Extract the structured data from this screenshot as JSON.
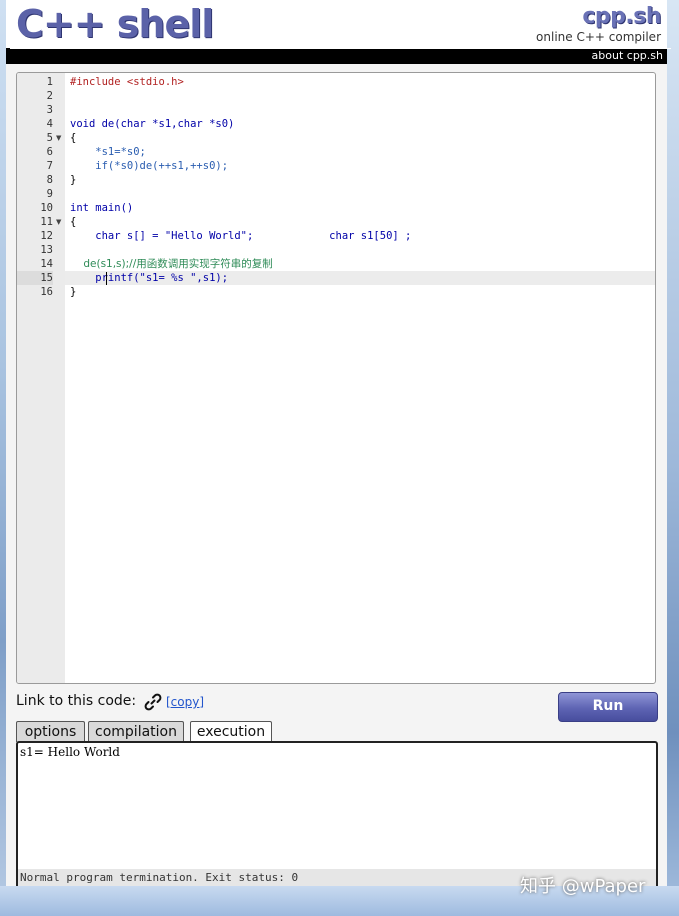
{
  "header": {
    "logo": "C++ shell",
    "brand": "cpp.sh",
    "tagline": "online C++ compiler",
    "about_link": "about cpp.sh"
  },
  "editor": {
    "line_numbers": [
      "1",
      "2",
      "3",
      "4",
      "5",
      "6",
      "7",
      "8",
      "9",
      "10",
      "11",
      "12",
      "13",
      "14",
      "15",
      "16"
    ],
    "fold_lines": [
      "5",
      "11"
    ],
    "active_line": "15",
    "lines": [
      "#include <stdio.h>",
      "",
      "",
      "void de(char *s1,char *s0)",
      "{",
      "    *s1=*s0;",
      "    if(*s0)de(++s1,++s0);",
      "}",
      "",
      "int main()",
      "{",
      "    char s[] = \"Hello World\";            char s1[50] ;",
      "",
      "    de(s1,s);//用函数调用实现字符串的复制",
      "    printf(\"s1= %s \",s1);",
      "}"
    ]
  },
  "link": {
    "label": "Link to this code:",
    "copy": "[copy]"
  },
  "run_label": "Run",
  "tabs": [
    {
      "label": "options"
    },
    {
      "label": "compilation"
    },
    {
      "label": "execution"
    }
  ],
  "output": {
    "text": "s1= Hello World",
    "status": "Normal program termination. Exit status: 0"
  },
  "watermark": "知乎 @wPaper",
  "colors": {
    "brand": "#5b62a8",
    "run_button": "#5e64b3",
    "link": "#2255cc",
    "keyword": "#0000a8",
    "include": "#b22222",
    "comment": "#2e8b57"
  }
}
